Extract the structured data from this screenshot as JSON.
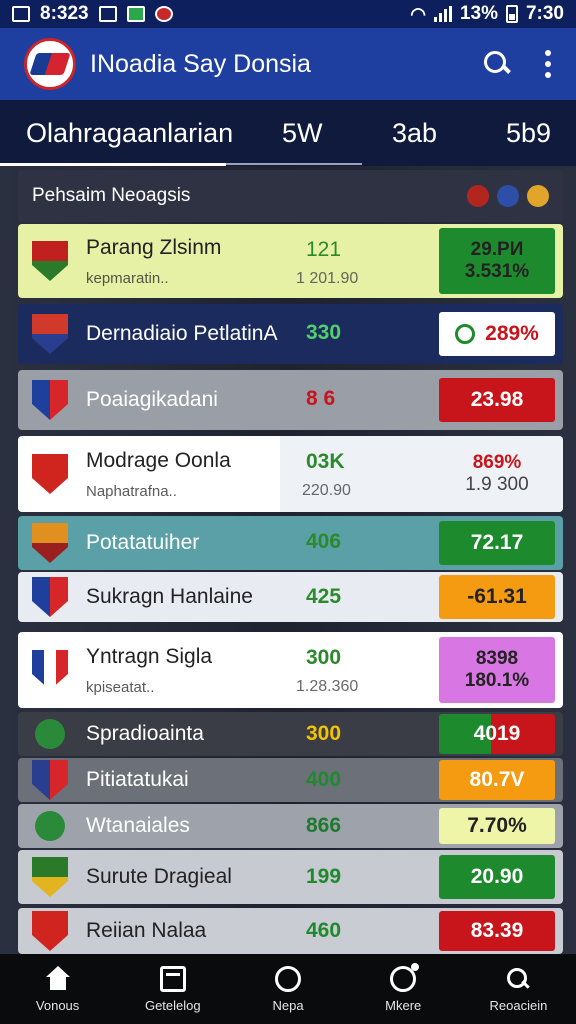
{
  "status_bar": {
    "time_left": "8:323",
    "battery": "13%",
    "time_right": "7:30"
  },
  "app": {
    "title": "INoadia Say Donsia"
  },
  "tabs": [
    {
      "label": "Olahragaanlarian"
    },
    {
      "label": "5Ԝ"
    },
    {
      "label": "3ab"
    },
    {
      "label": "5b9"
    }
  ],
  "section": {
    "title": "Pehsaim Neoagsis"
  },
  "rows": [
    {
      "name": "Parang Zlsinm",
      "sub": "kepmaratin..",
      "value": "121",
      "value2": "1 201.90",
      "pct": "29.PИ",
      "pct2": "3.531%"
    },
    {
      "name": "Dernadiaio PetlatinA",
      "value": "330",
      "pct": "289%"
    },
    {
      "name": "Poaiagikadani",
      "value": "8 6",
      "pct": "23.98"
    },
    {
      "name": "Modrage Oonla",
      "sub": "Naphatrafna..",
      "value": "03K",
      "value2": "220.90",
      "pct": "869%",
      "pct2": "1.9 300"
    },
    {
      "name": "Potatatuiher",
      "value": "406",
      "pct": "72.17"
    },
    {
      "name": "Sukragn Hanlaine",
      "value": "425",
      "pct": "-61.31"
    },
    {
      "name": "Yntragn Sigla",
      "sub": "kpiseatat..",
      "value": "300",
      "value2": "1.28.360",
      "pct": "8398",
      "pct2": "180.1%"
    },
    {
      "name": "Spradioainta",
      "value": "300",
      "pct": "4019"
    },
    {
      "name": "Pitiatatukai",
      "value": "400",
      "pct": "80.7V"
    },
    {
      "name": "Wtanaiales",
      "value": "866",
      "pct": "7.70%"
    },
    {
      "name": "Surute Dragieal",
      "value": "199",
      "pct": "20.90"
    },
    {
      "name": "Reiian Nalaa",
      "value": "460",
      "pct": "83.39"
    }
  ],
  "bottom_nav": [
    {
      "label": "Vonous"
    },
    {
      "label": "Getelelog"
    },
    {
      "label": "Nepa"
    },
    {
      "label": "Mkere"
    },
    {
      "label": "Reoaciein"
    }
  ],
  "colors": {
    "primary": "#1e3fa0",
    "green": "#1e8a2e",
    "red": "#c8141b",
    "orange": "#f49b12",
    "pink": "#d877e3"
  }
}
